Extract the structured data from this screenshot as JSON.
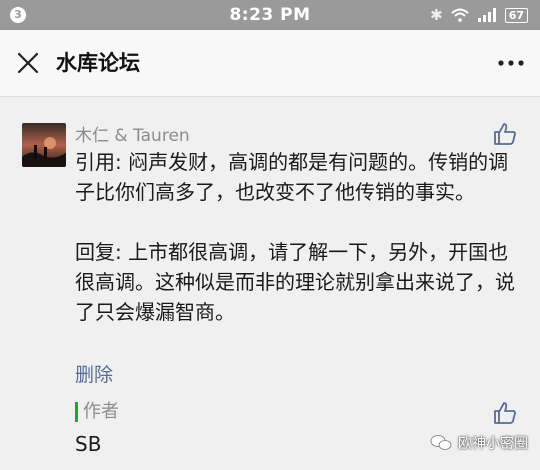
{
  "status_bar": {
    "notification_count": "3",
    "time": "8:23 PM",
    "battery": "67",
    "icons": [
      "bluetooth-icon",
      "wifi-icon",
      "signal-icon",
      "battery-icon"
    ]
  },
  "nav": {
    "title": "水库论坛",
    "close_icon": "close-icon",
    "more_icon": "more-icon"
  },
  "comment": {
    "author": "木仁 & Tauren",
    "quote": "引用: 闷声发财，高调的都是有问题的。传销的调子比你们高多了，也改变不了他传销的事实。",
    "reply": "回复: 上市都很高调，请了解一下，另外，开国也很高调。这种似是而非的理论就别拿出来说了，说了只会爆漏智商。",
    "delete_label": "删除"
  },
  "author_reply": {
    "label": "作者",
    "text": "SB"
  },
  "watermark": "欧神小密圈",
  "colors": {
    "status_bar": "#9a9a9a",
    "link": "#576b95",
    "author_bar": "#1aad19",
    "background": "#f0f0f0"
  }
}
